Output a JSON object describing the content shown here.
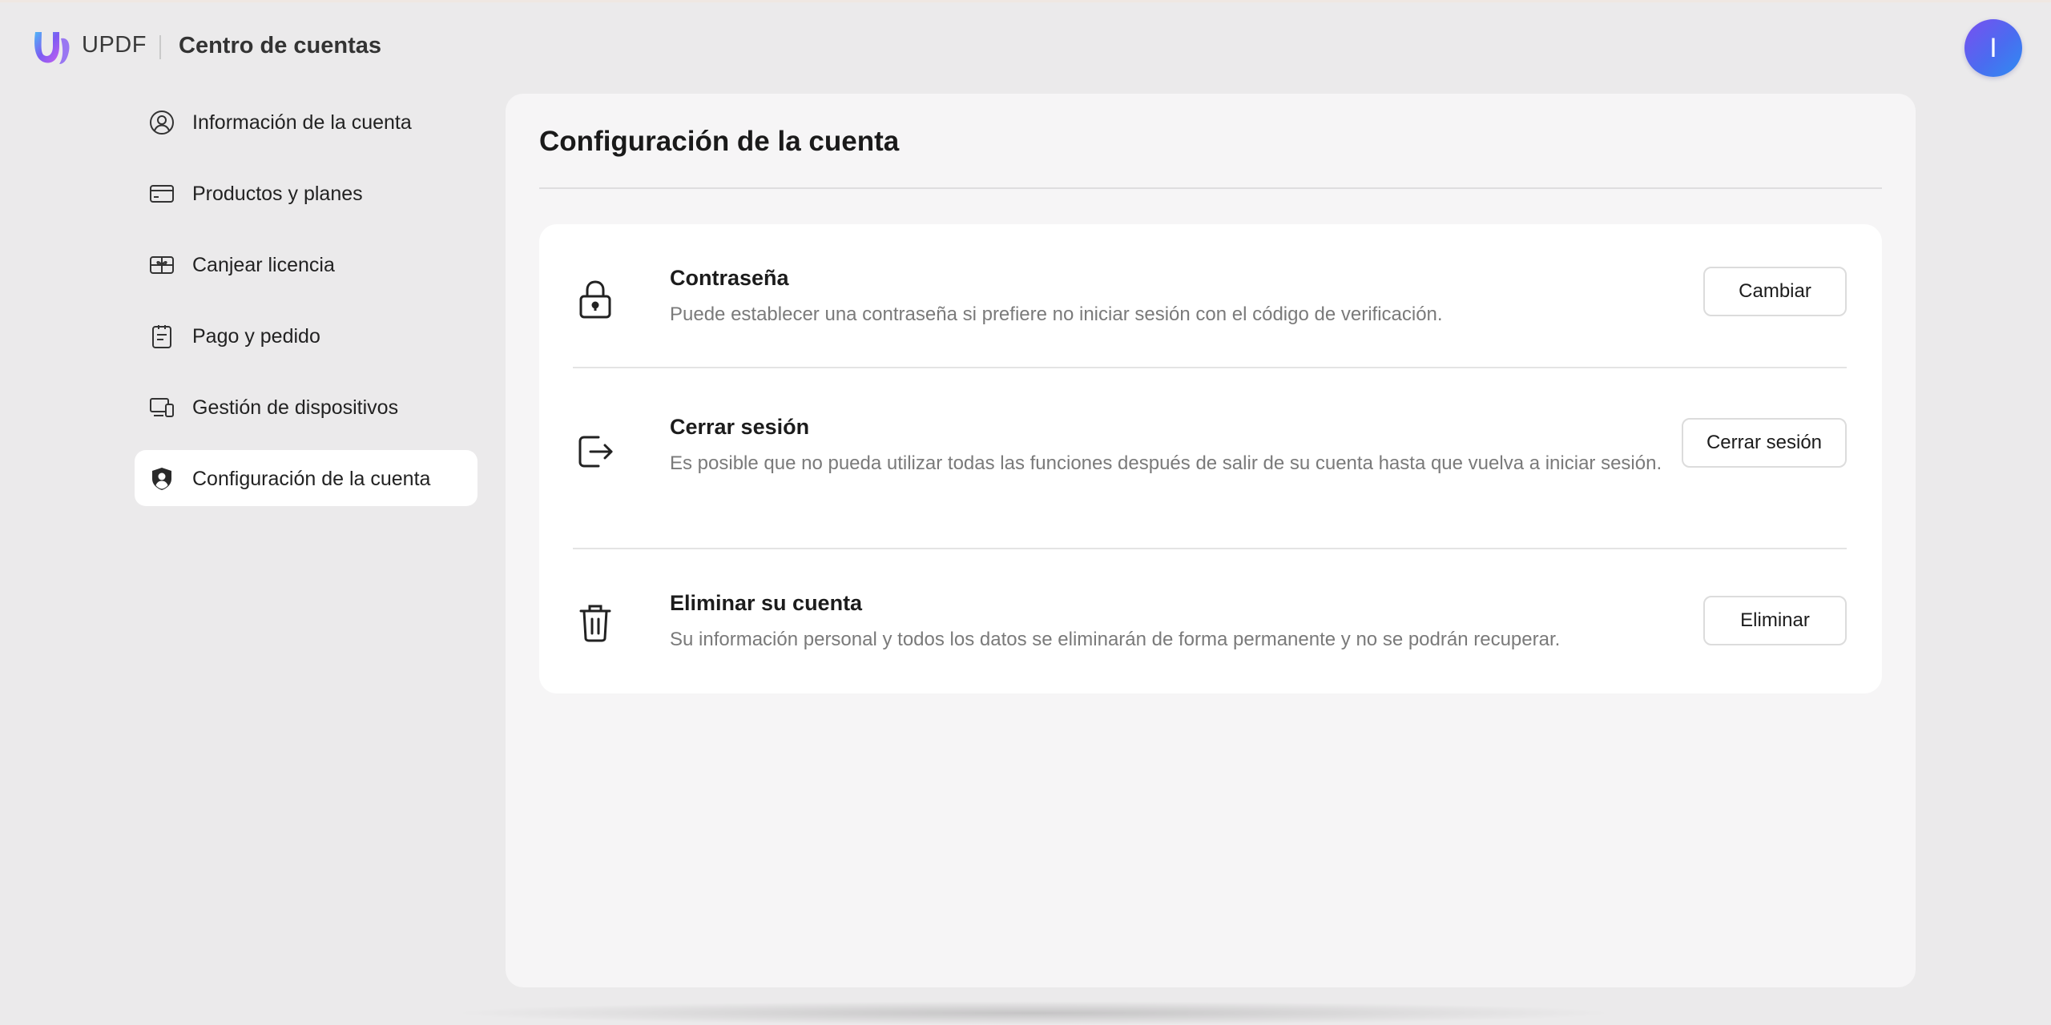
{
  "header": {
    "brand": "UPDF",
    "title": "Centro de cuentas",
    "avatar_initial": "I"
  },
  "sidebar": {
    "items": [
      {
        "label": "Información de la cuenta",
        "icon": "user-circle-icon",
        "active": false
      },
      {
        "label": "Productos y planes",
        "icon": "credit-card-icon",
        "active": false
      },
      {
        "label": "Canjear licencia",
        "icon": "gift-card-icon",
        "active": false
      },
      {
        "label": "Pago y pedido",
        "icon": "clipboard-icon",
        "active": false
      },
      {
        "label": "Gestión de dispositivos",
        "icon": "devices-icon",
        "active": false
      },
      {
        "label": "Configuración de la cuenta",
        "icon": "user-shield-icon",
        "active": true
      }
    ]
  },
  "main": {
    "title": "Configuración de la cuenta",
    "rows": [
      {
        "title": "Contraseña",
        "description": "Puede establecer una contraseña si prefiere no iniciar sesión con el código de verificación.",
        "button": "Cambiar",
        "icon": "lock-icon"
      },
      {
        "title": "Cerrar sesión",
        "description": "Es posible que no pueda utilizar todas las funciones después de salir de su cuenta hasta que vuelva a iniciar sesión.",
        "button": "Cerrar sesión",
        "icon": "logout-icon"
      },
      {
        "title": "Eliminar su cuenta",
        "description": "Su información personal y todos los datos se eliminarán de forma permanente y no se podrán recuperar.",
        "button": "Eliminar",
        "icon": "trash-icon"
      }
    ]
  },
  "colors": {
    "background": "#ebeaeb",
    "panel": "#f6f5f6",
    "card": "#ffffff",
    "avatar_gradient_start": "#7a4ff0",
    "avatar_gradient_end": "#2f8df2"
  }
}
